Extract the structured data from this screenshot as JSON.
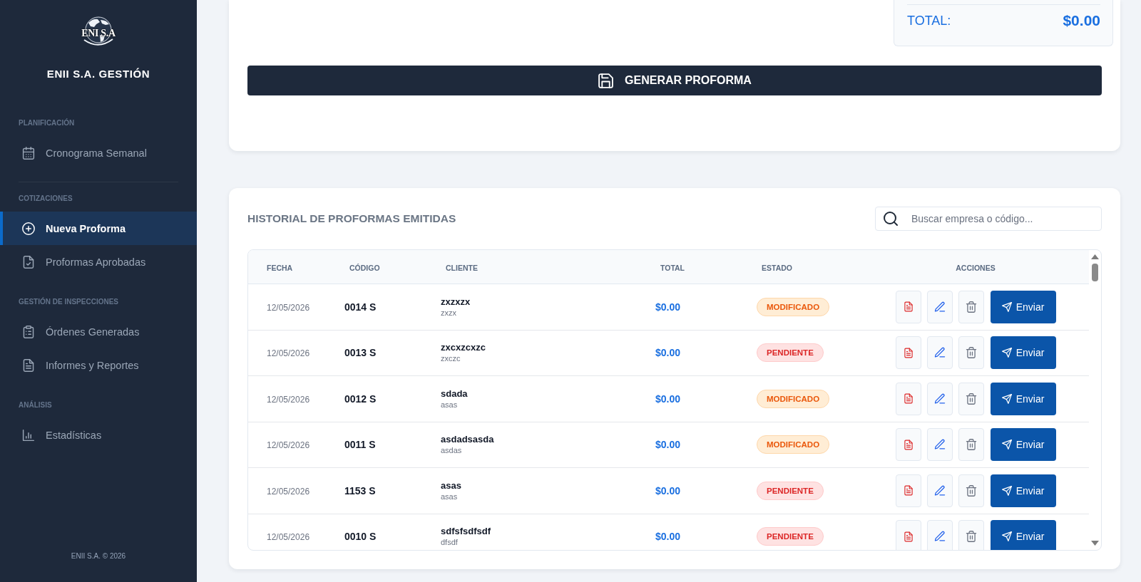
{
  "sidebar": {
    "logo_text": "ENI S.A",
    "title": "ENII S.A. GESTIÓN",
    "sections": [
      {
        "label": "PLANIFICACIÓN",
        "items": [
          {
            "label": "Cronograma Semanal",
            "selected": false
          }
        ]
      },
      {
        "label": "COTIZACIONES",
        "items": [
          {
            "label": "Nueva Proforma",
            "selected": true
          },
          {
            "label": "Proformas Aprobadas",
            "selected": false
          }
        ]
      },
      {
        "label": "GESTIÓN DE INSPECCIONES",
        "items": [
          {
            "label": "Órdenes Generadas",
            "selected": false
          },
          {
            "label": "Informes y Reportes",
            "selected": false
          }
        ]
      },
      {
        "label": "ANÁLISIS",
        "items": [
          {
            "label": "Estadísticas",
            "selected": false
          }
        ]
      }
    ],
    "footer": "ENII S.A. © 2026"
  },
  "summary": {
    "total_label": "TOTAL:",
    "total_value": "$0.00"
  },
  "generate_button": {
    "label": "GENERAR PROFORMA"
  },
  "history": {
    "title": "HISTORIAL DE PROFORMAS EMITIDAS",
    "search": {
      "placeholder": "Buscar empresa o código..."
    },
    "table": {
      "columns": [
        "FECHA",
        "CÓDIGO",
        "CLIENTE",
        "TOTAL",
        "ESTADO",
        "ACCIONES"
      ],
      "rows": [
        {
          "date": "12/05/2026",
          "code": "0014 S",
          "client": "zxzxzx",
          "client_detail": "zxzx",
          "total": "$0.00",
          "status": {
            "label": "MODIFICADO",
            "kind": "modified"
          },
          "send_label": "Enviar"
        },
        {
          "date": "12/05/2026",
          "code": "0013 S",
          "client": "zxcxzcxzc",
          "client_detail": "zxczc",
          "total": "$0.00",
          "status": {
            "label": "PENDIENTE",
            "kind": "pending"
          },
          "send_label": "Enviar"
        },
        {
          "date": "12/05/2026",
          "code": "0012 S",
          "client": "sdada",
          "client_detail": "asas",
          "total": "$0.00",
          "status": {
            "label": "MODIFICADO",
            "kind": "modified"
          },
          "send_label": "Enviar"
        },
        {
          "date": "12/05/2026",
          "code": "0011 S",
          "client": "asdadsasda",
          "client_detail": "asdas",
          "total": "$0.00",
          "status": {
            "label": "MODIFICADO",
            "kind": "modified"
          },
          "send_label": "Enviar"
        },
        {
          "date": "12/05/2026",
          "code": "1153 S",
          "client": "asas",
          "client_detail": "asas",
          "total": "$0.00",
          "status": {
            "label": "PENDIENTE",
            "kind": "pending"
          },
          "send_label": "Enviar"
        },
        {
          "date": "12/05/2026",
          "code": "0010 S",
          "client": "sdfsfsdfsdf",
          "client_detail": "dfsdf",
          "total": "$0.00",
          "status": {
            "label": "PENDIENTE",
            "kind": "pending"
          },
          "send_label": "Enviar"
        }
      ]
    }
  }
}
